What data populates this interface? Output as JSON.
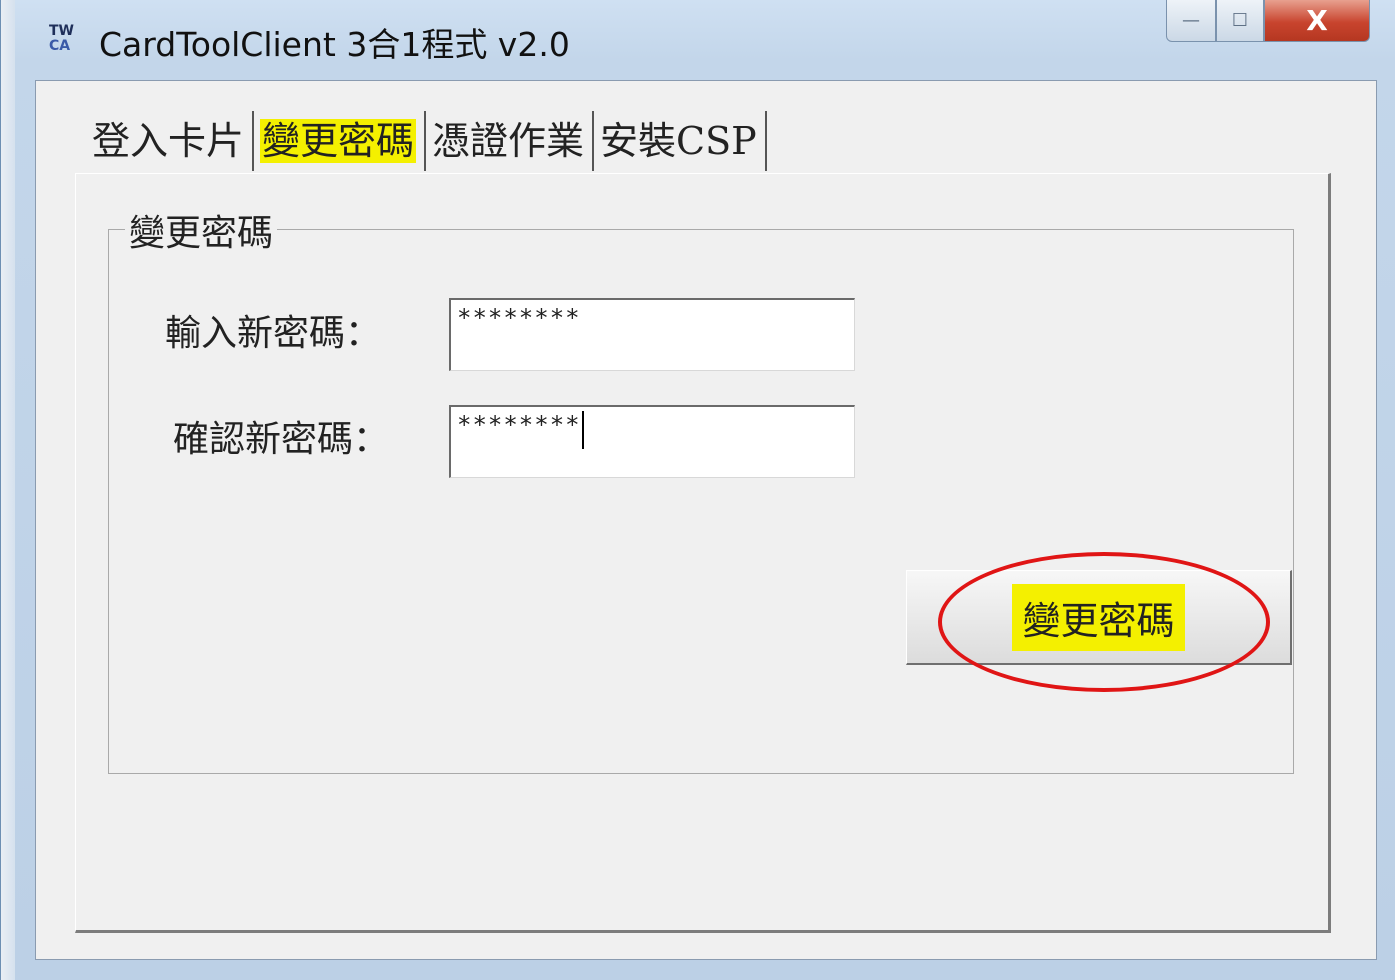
{
  "window": {
    "logo_top": "TW",
    "logo_bottom": "CA",
    "title": "CardToolClient 3合1程式 v2.0",
    "controls": {
      "minimize": "—",
      "maximize": "☐",
      "close": "X"
    }
  },
  "tabs": [
    {
      "label": "登入卡片",
      "active": false
    },
    {
      "label": "變更密碼",
      "active": true
    },
    {
      "label": "憑證作業",
      "active": false
    },
    {
      "label": "安裝CSP",
      "active": false
    }
  ],
  "group": {
    "title": "變更密碼",
    "new_password_label": "輸入新密碼：",
    "new_password_value": "********",
    "confirm_password_label": "確認新密碼：",
    "confirm_password_value": "********",
    "submit_label": "變更密碼"
  },
  "colors": {
    "highlight": "#f4f000",
    "annotation_ring": "#e01515",
    "close_button": "#c8442e"
  }
}
